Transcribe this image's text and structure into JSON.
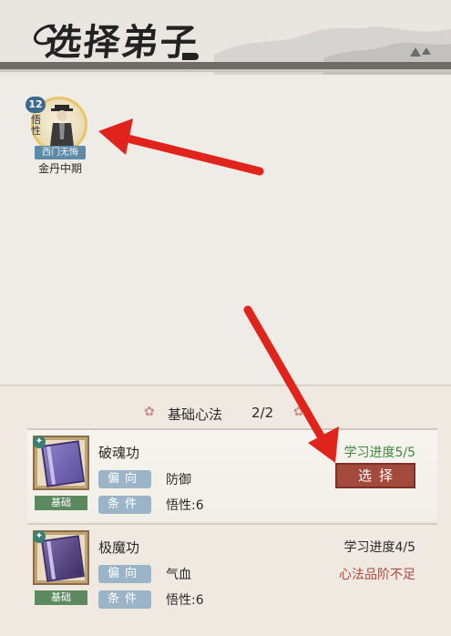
{
  "header": {
    "title": "选择弟子"
  },
  "disciple": {
    "level": "12",
    "attribute": "悟性",
    "name": "西门无悔",
    "stage": "金丹中期"
  },
  "techniques_section": {
    "title": "基础心法",
    "count": "2/2"
  },
  "techniques": [
    {
      "name": "破魂功",
      "tag": "基础",
      "direction_label": "偏向",
      "direction": "防御",
      "condition_label": "条件",
      "condition": "悟性:6",
      "progress": "学习进度5/5",
      "action": "选择"
    },
    {
      "name": "极魔功",
      "tag": "基础",
      "direction_label": "偏向",
      "direction": "气血",
      "condition_label": "条件",
      "condition": "悟性:6",
      "progress": "学习进度4/5",
      "status": "心法品阶不足"
    }
  ],
  "colors": {
    "accent_button": "#a44a3c",
    "progress_complete": "#3d8a3a",
    "warning": "#b24a3a",
    "tag_green": "#5b8a5e",
    "pill_blue": "#9cb4c8"
  }
}
